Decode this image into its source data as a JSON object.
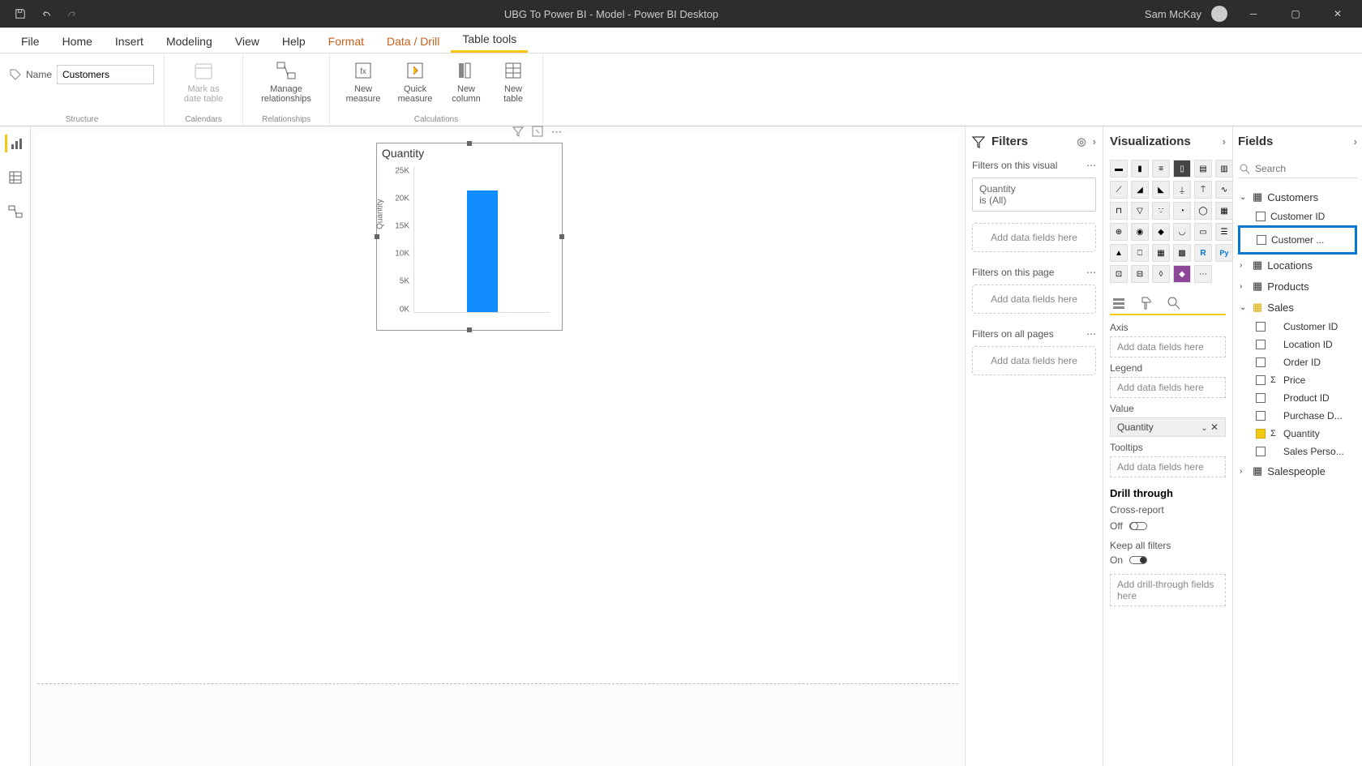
{
  "titlebar": {
    "title": "UBG To Power BI - Model - Power BI Desktop",
    "user": "Sam McKay"
  },
  "menu": {
    "items": [
      "File",
      "Home",
      "Insert",
      "Modeling",
      "View",
      "Help",
      "Format",
      "Data / Drill",
      "Table tools"
    ]
  },
  "ribbon": {
    "name_label": "Name",
    "name_value": "Customers",
    "mark_date": "Mark as date table",
    "manage_rel": "Manage relationships",
    "new_measure": "New measure",
    "quick_measure": "Quick measure",
    "new_column": "New column",
    "new_table": "New table",
    "groups": {
      "structure": "Structure",
      "calendars": "Calendars",
      "relationships": "Relationships",
      "calculations": "Calculations"
    }
  },
  "chart_data": {
    "type": "bar",
    "title": "Quantity",
    "ylabel": "Quantity",
    "categories": [
      ""
    ],
    "values": [
      22000
    ],
    "yticks": [
      "25K",
      "20K",
      "15K",
      "10K",
      "5K",
      "0K"
    ],
    "ylim": [
      0,
      25000
    ]
  },
  "filters": {
    "header": "Filters",
    "on_visual": "Filters on this visual",
    "on_page": "Filters on this page",
    "on_all": "Filters on all pages",
    "card_field": "Quantity",
    "card_cond": "is (All)",
    "add": "Add data fields here"
  },
  "viz": {
    "header": "Visualizations",
    "axis": "Axis",
    "legend": "Legend",
    "value": "Value",
    "value_field": "Quantity",
    "tooltips": "Tooltips",
    "add": "Add data fields here",
    "drill_through": "Drill through",
    "cross_report": "Cross-report",
    "off": "Off",
    "keep_filters": "Keep all filters",
    "on": "On",
    "add_drill": "Add drill-through fields here"
  },
  "fields": {
    "header": "Fields",
    "search_ph": "Search",
    "tables": {
      "customers": "Customers",
      "customers_f1": "Customer ID",
      "customers_f2": "Customer ...",
      "locations": "Locations",
      "products": "Products",
      "sales": "Sales",
      "salespeople": "Salespeople"
    },
    "sales_fields": {
      "customer_id": "Customer ID",
      "location_id": "Location ID",
      "order_id": "Order ID",
      "price": "Price",
      "product_id": "Product ID",
      "purchase_d": "Purchase D...",
      "quantity": "Quantity",
      "sales_perso": "Sales Perso..."
    }
  }
}
